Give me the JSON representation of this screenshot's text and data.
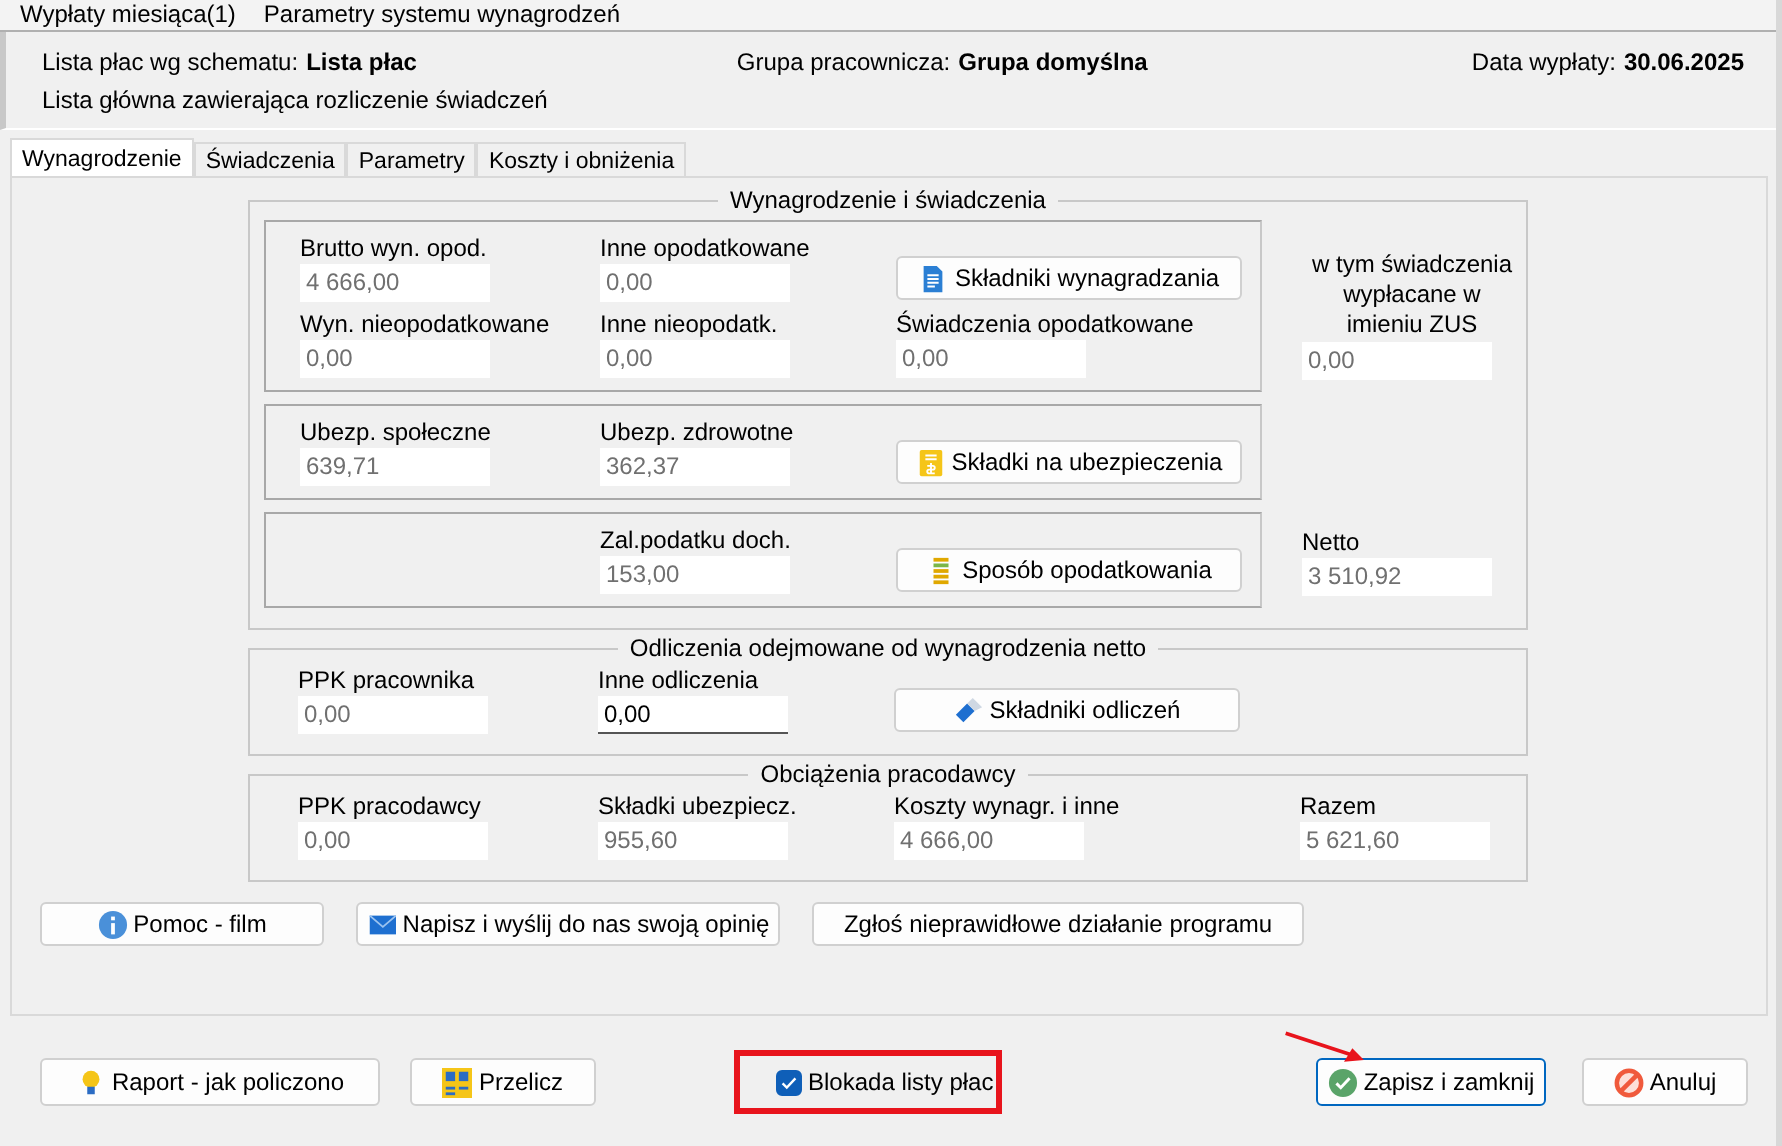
{
  "menu": [
    {
      "label": "Wypłaty miesiąca(1)"
    },
    {
      "label": "Parametry systemu wynagrodzeń"
    }
  ],
  "header": {
    "schema_label": "Lista płac wg schematu:",
    "schema_value": "Lista płac",
    "description": "Lista główna zawierająca rozliczenie świadczeń",
    "group_label": "Grupa pracownicza:",
    "group_value": "Grupa domyślna",
    "date_label": "Data wypłaty:",
    "date_value": "30.06.2025"
  },
  "tabs": [
    {
      "label": "Wynagrodzenie",
      "selected": true
    },
    {
      "label": "Świadczenia",
      "selected": false
    },
    {
      "label": "Parametry",
      "selected": false
    },
    {
      "label": "Koszty i obniżenia",
      "selected": false
    }
  ],
  "salary": {
    "title": "Wynagrodzenie i świadczenia",
    "sections": [
      {
        "items": [
          {
            "kind": "field",
            "label": "Brutto wyn. opod.",
            "value": "4 666,00",
            "disabled": true
          },
          {
            "kind": "field",
            "label": "Inne opodatkowane",
            "value": "0,00",
            "disabled": true
          },
          {
            "kind": "button",
            "label": "Składniki wynagradzania"
          },
          {
            "kind": "field",
            "label": "Wyn. nieopodatkowane",
            "value": "0,00",
            "disabled": true
          },
          {
            "kind": "field",
            "label": "Inne nieopodatk.",
            "value": "0,00",
            "disabled": true
          },
          {
            "kind": "field",
            "label": "Świadczenia opodatkowane",
            "value": "0,00",
            "disabled": true
          }
        ]
      },
      {
        "items": [
          {
            "kind": "field",
            "label": "Ubezp. społeczne",
            "value": "639,71",
            "disabled": true
          },
          {
            "kind": "field",
            "label": "Ubezp. zdrowotne",
            "value": "362,37",
            "disabled": true
          },
          {
            "kind": "button",
            "label": "Składki na ubezpieczenia"
          }
        ]
      },
      {
        "items": [
          {
            "kind": "field",
            "label": "Zal.podatku doch.",
            "value": "153,00",
            "disabled": true
          },
          {
            "kind": "button",
            "label": "Sposób opodatkowania"
          }
        ]
      }
    ],
    "side": [
      {
        "label": "w tym świadczenia wypłacane w imieniu ZUS",
        "value": "0,00",
        "disabled": true
      },
      {
        "label": "Netto",
        "value": "3 510,92",
        "disabled": true
      }
    ]
  },
  "deductions": {
    "title": "Odliczenia odejmowane od wynagrodzenia netto",
    "items": [
      {
        "kind": "field",
        "label": "PPK pracownika",
        "value": "0,00",
        "disabled": true
      },
      {
        "kind": "field",
        "label": "Inne odliczenia",
        "value": "0,00",
        "disabled": false
      },
      {
        "kind": "button",
        "label": "Składniki odliczeń"
      }
    ]
  },
  "employer": {
    "title": "Obciążenia pracodawcy",
    "items": [
      {
        "kind": "field",
        "label": "PPK pracodawcy",
        "value": "0,00",
        "disabled": true
      },
      {
        "kind": "field",
        "label": "Składki ubezpiecz.",
        "value": "955,60",
        "disabled": true
      },
      {
        "kind": "field",
        "label": "Koszty wynagr. i inne",
        "value": "4 666,00",
        "disabled": true
      },
      {
        "kind": "field",
        "label": "Razem",
        "value": "5 621,60",
        "disabled": true
      }
    ]
  },
  "help_buttons": [
    {
      "label": "Pomoc - film"
    },
    {
      "label": "Napisz i wyślij do nas swoją opinię"
    },
    {
      "label": "Zgłoś nieprawidłowe działanie programu"
    }
  ],
  "actions": [
    {
      "label": "Raport - jak policzono",
      "focused": false
    },
    {
      "label": "Przelicz",
      "focused": false
    }
  ],
  "lock": {
    "label": "Blokada listy płac",
    "checked": true
  },
  "dialog_buttons": [
    {
      "label": "Zapisz i zamknij",
      "focused": true
    },
    {
      "label": "Anuluj",
      "focused": false
    }
  ]
}
